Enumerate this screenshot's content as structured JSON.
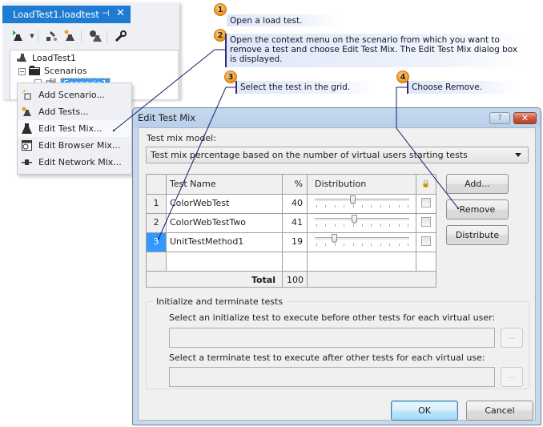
{
  "vs_panel": {
    "tab_title": "LoadTest1.loadtest",
    "pin_icon": "pin-icon",
    "close_icon": "close-icon",
    "toolbar_icons": [
      "run-load-test-icon",
      "dropdown-arrow-icon",
      "manage-rigs-icon",
      "add-test-icon",
      "test-settings-icon",
      "properties-wrench-icon"
    ],
    "tree": {
      "root": "LoadTest1",
      "scenarios_folder": "Scenarios",
      "selected_scenario": "Scenario1"
    }
  },
  "context_menu": {
    "items": [
      {
        "label": "Add Scenario...",
        "icon": "add-scenario-icon"
      },
      {
        "label": "Add Tests...",
        "icon": "add-tests-icon"
      },
      {
        "label": "Edit Test Mix...",
        "icon": "flask-icon",
        "highlighted": true
      },
      {
        "label": "Edit Browser Mix...",
        "icon": "browser-icon"
      },
      {
        "label": "Edit Network Mix...",
        "icon": "network-icon"
      }
    ]
  },
  "callouts": [
    {
      "number": "1",
      "text": "Open a load test."
    },
    {
      "number": "2",
      "text": "Open the context menu on the scenario from which you want to remove a test and choose Edit Test Mix. The Edit Test Mix dialog box is displayed."
    },
    {
      "number": "3",
      "text": "Select the test in the grid."
    },
    {
      "number": "4",
      "text": "Choose Remove."
    }
  ],
  "dialog": {
    "title": "Edit Test Mix",
    "help_label": "?",
    "close_label": "✕",
    "mix_model_label": "Test mix model:",
    "mix_model_value": "Test mix percentage based on the number of virtual users starting tests",
    "grid": {
      "columns": [
        "",
        "Test Name",
        "%",
        "Distribution",
        "lock-icon"
      ],
      "rows": [
        {
          "num": "1",
          "name": "ColorWebTest",
          "percent": "40",
          "distribution": 40,
          "locked": false,
          "selected": false
        },
        {
          "num": "2",
          "name": "ColorWebTestTwo",
          "percent": "41",
          "distribution": 41,
          "locked": false,
          "selected": false
        },
        {
          "num": "3",
          "name": "UnitTestMethod1",
          "percent": "19",
          "distribution": 19,
          "locked": false,
          "selected": true
        }
      ],
      "total_label": "Total",
      "total_value": "100"
    },
    "buttons": {
      "add": "Add...",
      "remove": "Remove",
      "distribute": "Distribute",
      "ok": "OK",
      "cancel": "Cancel"
    },
    "init_group": {
      "legend": "Initialize and terminate tests",
      "init_label": "Select an initialize test to execute before other tests for each virtual user:",
      "init_value": "",
      "terminate_label": "Select a terminate test to execute after other tests for each virtual use:",
      "terminate_value": "",
      "browse_label": "..."
    }
  }
}
